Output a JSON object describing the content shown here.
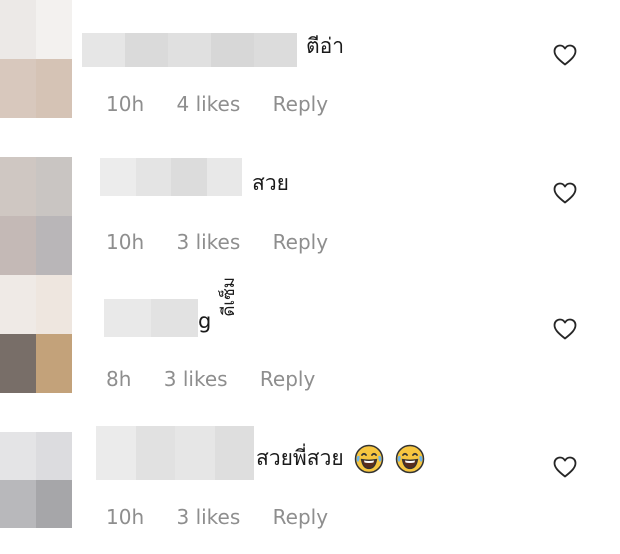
{
  "comments": [
    {
      "text": "ตีอ่า",
      "time": "10h",
      "likes": "4 likes",
      "reply": "Reply",
      "avatar_colors": [
        "#ece9e7",
        "#f3f1ef",
        "#d8c8bd",
        "#d5c3b5"
      ],
      "username_colors": [
        "#e6e6e6",
        "#dadada",
        "#e0e0e0",
        "#d7d7d7",
        "#dcdcdc"
      ]
    },
    {
      "text": "สวย",
      "time": "10h",
      "likes": "3 likes",
      "reply": "Reply",
      "avatar_colors": [
        "#cfc7c2",
        "#c9c5c2",
        "#c4b9b6",
        "#b9b6b8"
      ],
      "username_colors": [
        "#ececec",
        "#e4e4e4",
        "#dcdcdc",
        "#e8e8e8"
      ]
    },
    {
      "text": "g",
      "vertical_text": "ดีเซ็ม",
      "time": "8h",
      "likes": "3 likes",
      "reply": "Reply",
      "avatar_colors": [
        "#efeae6",
        "#eee6df",
        "#786e68",
        "#c3a27a"
      ],
      "username_colors": [
        "#e9e9e9",
        "#e2e2e2"
      ]
    },
    {
      "text": "สวยพี่สวย",
      "emoji_count": 2,
      "time": "10h",
      "likes": "3 likes",
      "reply": "Reply",
      "avatar_colors": [
        "#e4e4e6",
        "#dcdcdf",
        "#b8b8bb",
        "#a6a6a9"
      ],
      "username_colors": [
        "#ebebeb",
        "#e1e1e1",
        "#e6e6e6",
        "#dedede"
      ]
    }
  ],
  "icons": {
    "heart": "heart-icon",
    "emoji": "laughing-tears-emoji-icon"
  }
}
